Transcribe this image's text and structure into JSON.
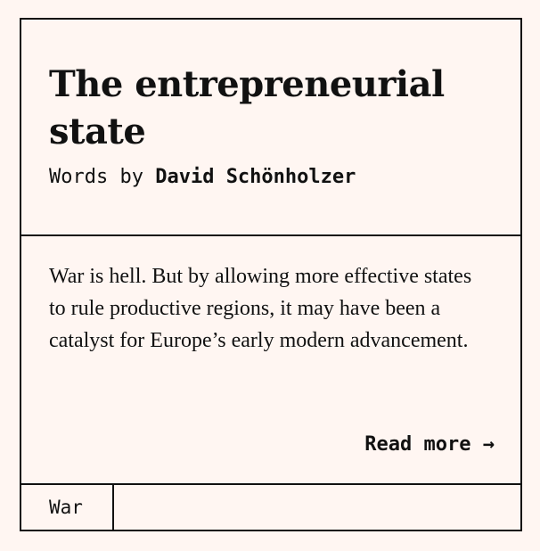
{
  "article": {
    "title": "The entrepreneurial state",
    "byline_prefix": "Words by",
    "author": "David Schönholzer",
    "excerpt": "War is hell. But by allowing more effective states to rule productive regions, it may have been a catalyst for Europe’s early modern advancement.",
    "read_more_label": "Read more →",
    "tags": [
      "War"
    ]
  },
  "colors": {
    "background": "#fff6f2",
    "text": "#111111",
    "border": "#111111"
  }
}
